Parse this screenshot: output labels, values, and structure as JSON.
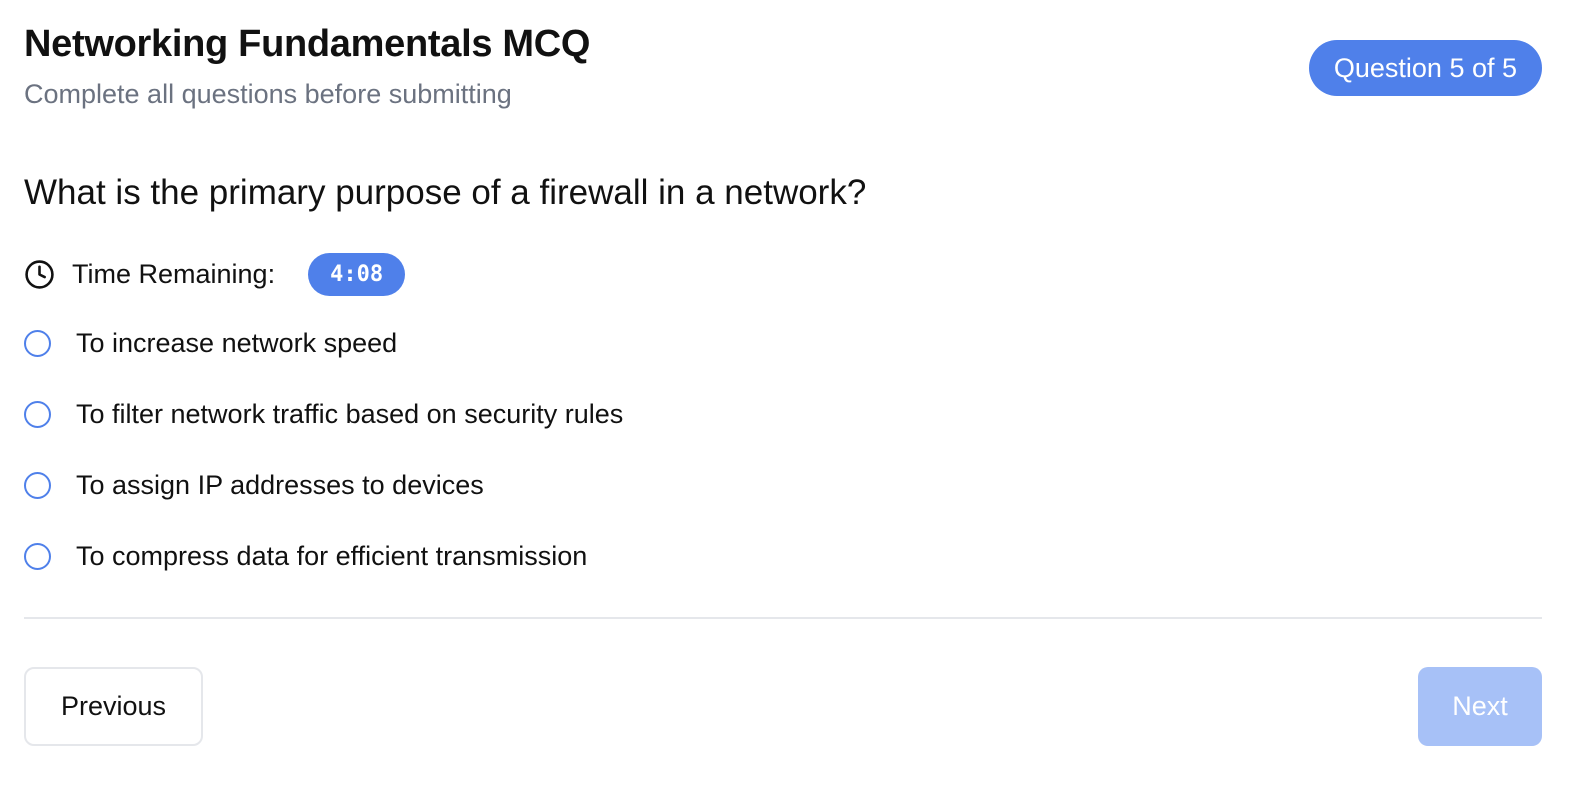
{
  "header": {
    "title": "Networking Fundamentals MCQ",
    "subtitle": "Complete all questions before submitting"
  },
  "progress": {
    "label": "Question 5 of 5",
    "current": 5,
    "total": 5
  },
  "question": {
    "text": "What is the primary purpose of a firewall in a network?"
  },
  "timer": {
    "label": "Time Remaining:",
    "value": "4:08",
    "icon": "clock-icon"
  },
  "options": [
    {
      "label": "To increase network speed",
      "selected": false
    },
    {
      "label": "To filter network traffic based on security rules",
      "selected": false
    },
    {
      "label": "To assign IP addresses to devices",
      "selected": false
    },
    {
      "label": "To compress data for efficient transmission",
      "selected": false
    }
  ],
  "navigation": {
    "previous_label": "Previous",
    "next_label": "Next",
    "next_disabled": true
  },
  "colors": {
    "accent": "#4f80ea",
    "accent_disabled": "#a7c1f7",
    "muted_text": "#6b7280",
    "border": "#e5e7eb"
  }
}
